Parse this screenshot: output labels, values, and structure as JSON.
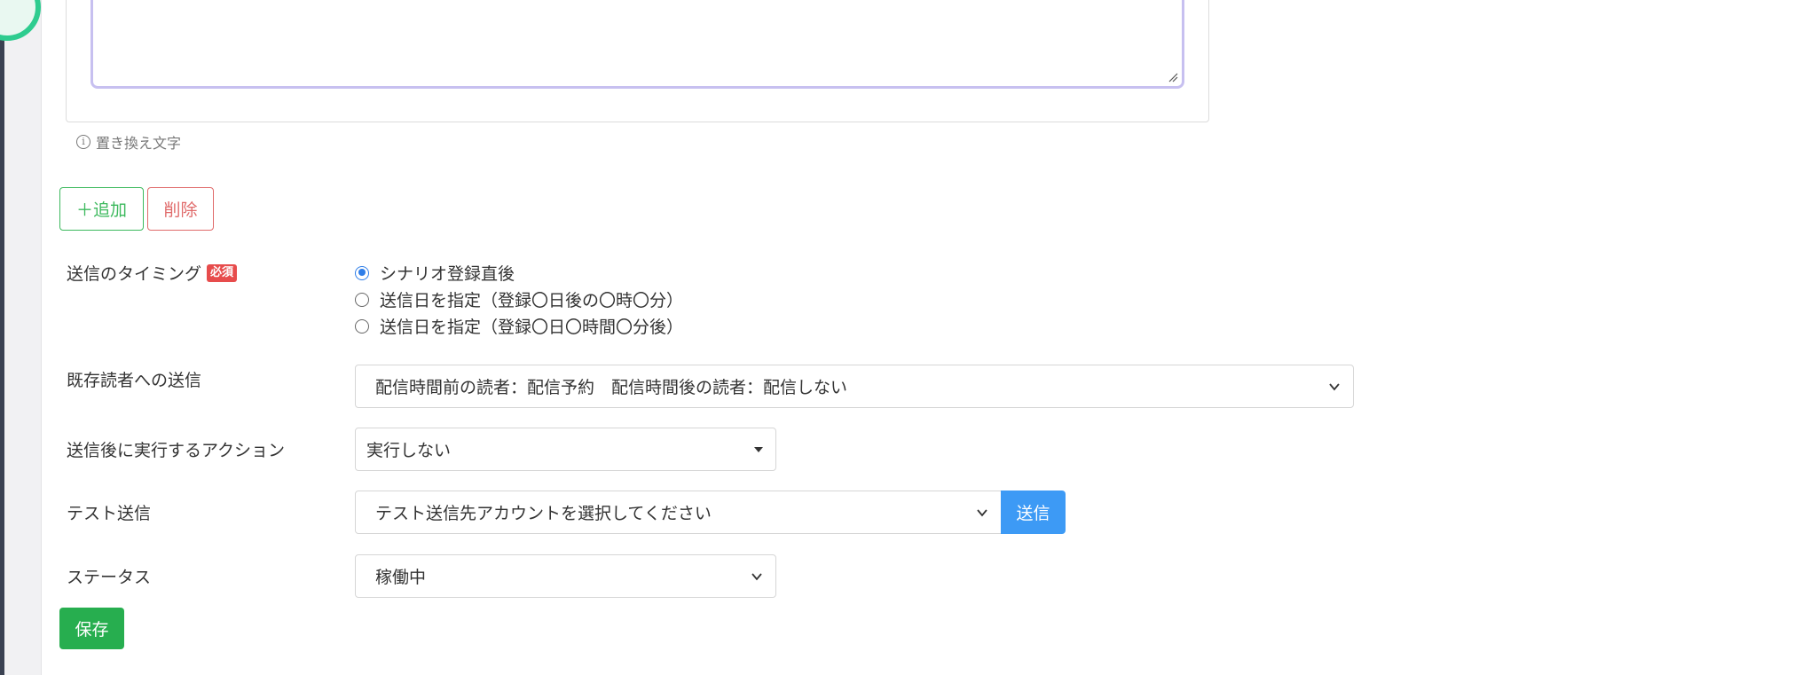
{
  "hint": {
    "text": "置き換え文字"
  },
  "buttons": {
    "add": "＋追加",
    "delete": "削除",
    "send": "送信",
    "save": "保存"
  },
  "timing": {
    "label": "送信のタイミング",
    "required_badge": "必須",
    "options": [
      {
        "label": "シナリオ登録直後",
        "checked": true
      },
      {
        "label": "送信日を指定（登録〇日後の〇時〇分）",
        "checked": false
      },
      {
        "label": "送信日を指定（登録〇日〇時間〇分後）",
        "checked": false
      }
    ]
  },
  "existing_readers": {
    "label": "既存読者への送信",
    "selected": "配信時間前の読者：配信予約　配信時間後の読者：配信しない"
  },
  "after_action": {
    "label": "送信後に実行するアクション",
    "selected": "実行しない"
  },
  "test_send": {
    "label": "テスト送信",
    "selected": "テスト送信先アカウントを選択してください"
  },
  "status": {
    "label": "ステータス",
    "selected": "稼働中"
  },
  "colors": {
    "accent_blue": "#3d9af5",
    "success_green": "#27ae4f",
    "danger_red": "#e06a6a",
    "required_badge": "#e74c4c"
  }
}
